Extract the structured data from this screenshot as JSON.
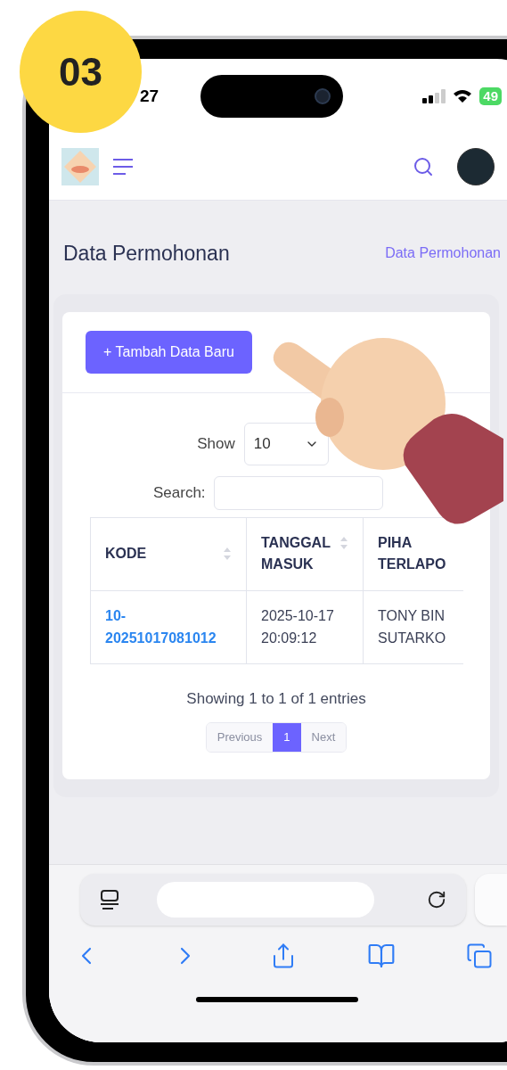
{
  "badge": "03",
  "status_bar": {
    "time": "27",
    "battery": "49"
  },
  "page": {
    "title": "Data Permohonan",
    "breadcrumb": "Data Permohonan"
  },
  "add_button": "+ Tambah Data Baru",
  "length_menu": {
    "label": "Show",
    "value": "10"
  },
  "search": {
    "label": "Search:"
  },
  "table": {
    "columns": [
      {
        "label": "KODE",
        "sortable": true
      },
      {
        "label": "TANGGAL MASUK",
        "sortable": true
      },
      {
        "label": "PIHA TERLAPO",
        "sortable": false
      }
    ],
    "rows": [
      {
        "cells": [
          "10-20251017081012",
          "2025-10-17 20:09:12",
          "TONY BIN SUTARKO"
        ]
      }
    ]
  },
  "info": "Showing 1 to 1 of 1 entries",
  "pagination": [
    {
      "label": "Previous",
      "selected": false
    },
    {
      "label": "1",
      "selected": true
    },
    {
      "label": "Next",
      "selected": false
    }
  ]
}
